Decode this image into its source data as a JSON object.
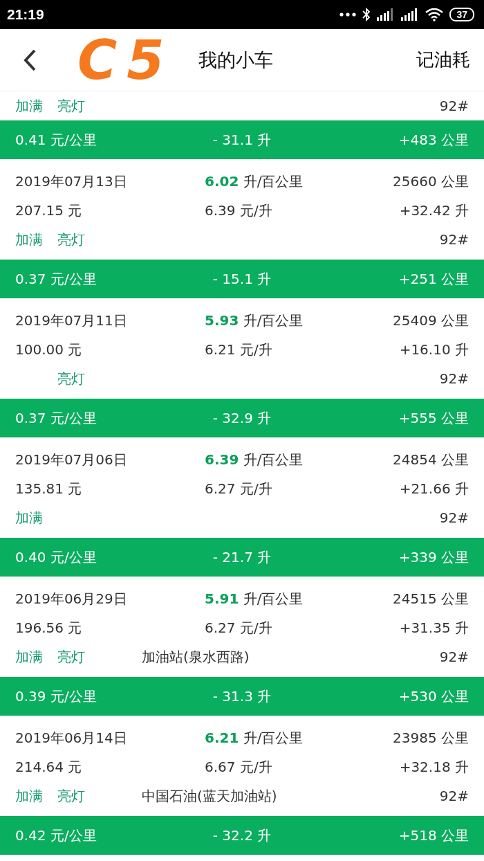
{
  "status_bar": {
    "time": "21:19",
    "battery": "37"
  },
  "header": {
    "title": "我的小车",
    "action": "记油耗"
  },
  "annotation": "C5",
  "items": [
    {
      "kind": "record",
      "tags": [
        {
          "kind": "full",
          "label": "加满"
        },
        {
          "kind": "light",
          "label": "亮灯"
        }
      ],
      "grade": "92#"
    },
    {
      "kind": "summary",
      "cost_per_km": "0.41 元/公里",
      "fuel": "- 31.1 升",
      "distance": "+483 公里"
    },
    {
      "kind": "record",
      "date": "2019年07月13日",
      "consumption": "6.02",
      "consumption_unit": "升/百公里",
      "odometer": "25660 公里",
      "amount": "207.15 元",
      "price": "6.39 元/升",
      "liters": "+32.42 升",
      "tags": [
        {
          "kind": "full",
          "label": "加满"
        },
        {
          "kind": "light",
          "label": "亮灯"
        }
      ],
      "grade": "92#"
    },
    {
      "kind": "summary",
      "cost_per_km": "0.37 元/公里",
      "fuel": "- 15.1 升",
      "distance": "+251 公里"
    },
    {
      "kind": "record",
      "date": "2019年07月11日",
      "consumption": "5.93",
      "consumption_unit": "升/百公里",
      "odometer": "25409 公里",
      "amount": "100.00 元",
      "price": "6.21 元/升",
      "liters": "+16.10 升",
      "tags": [
        {
          "kind": "light",
          "label": "亮灯"
        }
      ],
      "grade": "92#"
    },
    {
      "kind": "summary",
      "cost_per_km": "0.37 元/公里",
      "fuel": "- 32.9 升",
      "distance": "+555 公里"
    },
    {
      "kind": "record",
      "date": "2019年07月06日",
      "consumption": "6.39",
      "consumption_unit": "升/百公里",
      "odometer": "24854 公里",
      "amount": "135.81 元",
      "price": "6.27 元/升",
      "liters": "+21.66 升",
      "tags": [
        {
          "kind": "full",
          "label": "加满"
        }
      ],
      "grade": "92#"
    },
    {
      "kind": "summary",
      "cost_per_km": "0.40 元/公里",
      "fuel": "- 21.7 升",
      "distance": "+339 公里"
    },
    {
      "kind": "record",
      "date": "2019年06月29日",
      "consumption": "5.91",
      "consumption_unit": "升/百公里",
      "odometer": "24515 公里",
      "amount": "196.56 元",
      "price": "6.27 元/升",
      "liters": "+31.35 升",
      "tags": [
        {
          "kind": "full",
          "label": "加满"
        },
        {
          "kind": "light",
          "label": "亮灯"
        }
      ],
      "station": "加油站(泉水西路)",
      "grade": "92#"
    },
    {
      "kind": "summary",
      "cost_per_km": "0.39 元/公里",
      "fuel": "- 31.3 升",
      "distance": "+530 公里"
    },
    {
      "kind": "record",
      "date": "2019年06月14日",
      "consumption": "6.21",
      "consumption_unit": "升/百公里",
      "odometer": "23985 公里",
      "amount": "214.64 元",
      "price": "6.67 元/升",
      "liters": "+32.18 升",
      "tags": [
        {
          "kind": "full",
          "label": "加满"
        },
        {
          "kind": "light",
          "label": "亮灯"
        }
      ],
      "station": "中国石油(蓝天加油站)",
      "grade": "92#"
    },
    {
      "kind": "summary",
      "cost_per_km": "0.42 元/公里",
      "fuel": "- 32.2 升",
      "distance": "+518 公里"
    }
  ]
}
